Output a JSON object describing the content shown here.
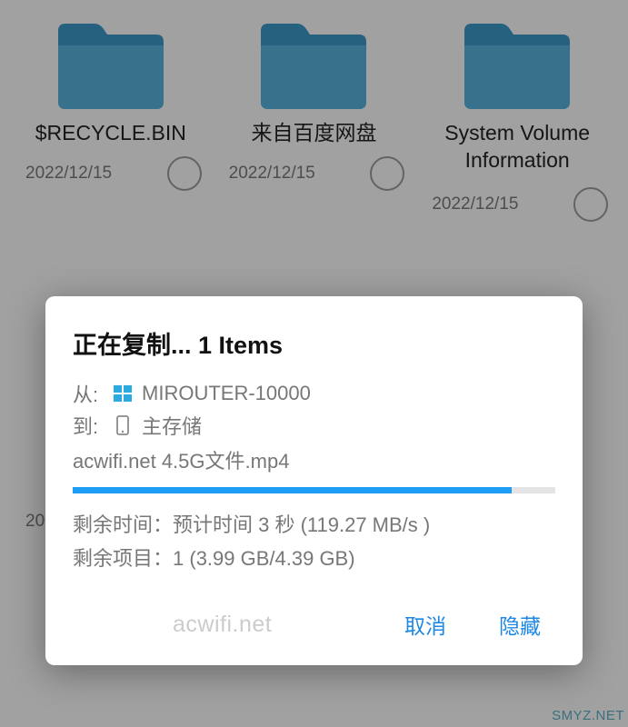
{
  "folders": [
    {
      "name": "$RECYCLE.BIN",
      "date": "2022/12/15"
    },
    {
      "name": "来自百度网盘",
      "date": "2022/12/15"
    },
    {
      "name": "System Volume Information",
      "date": "2022/12/15"
    }
  ],
  "partial_date": "20",
  "dialog": {
    "title": "正在复制... 1 Items",
    "from_label": "从:",
    "from_value": "MIROUTER-10000",
    "to_label": "到:",
    "to_value": "主存储",
    "filename": "acwifi.net 4.5G文件.mp4",
    "progress_percent": 91,
    "time_label": "剩余时间：",
    "time_value": "预计时间 3 秒 (119.27 MB/s )",
    "items_label": "剩余项目：",
    "items_value": "1 (3.99 GB/4.39 GB)",
    "cancel": "取消",
    "hide": "隐藏"
  },
  "watermark_center": "acwifi.net",
  "watermark_corner": "SMYZ.NET"
}
